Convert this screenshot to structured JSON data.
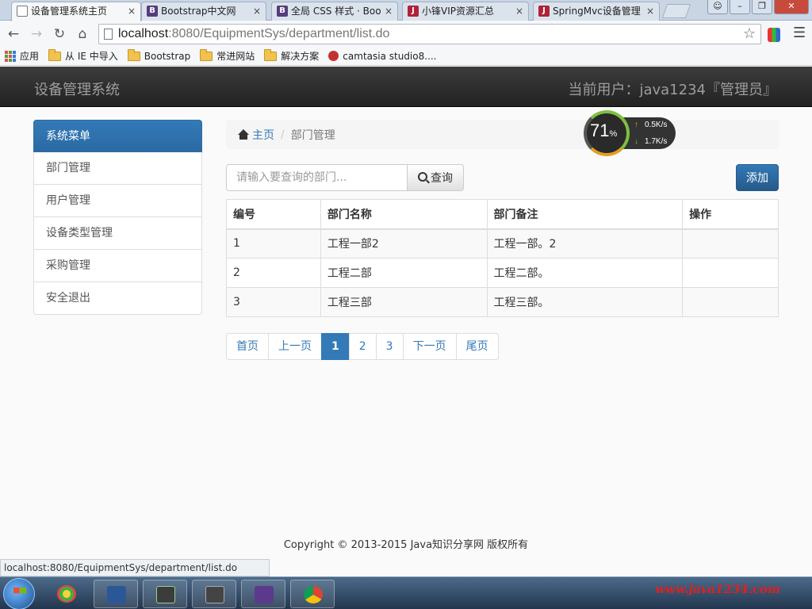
{
  "browser": {
    "tabs": [
      {
        "label": "设备管理系统主页",
        "favicon": "page-icon",
        "active": true
      },
      {
        "label": "Bootstrap中文网",
        "favicon": "B",
        "active": false
      },
      {
        "label": "全局 CSS 样式 · Boo",
        "favicon": "B",
        "active": false
      },
      {
        "label": "小锋VIP资源汇总",
        "favicon": "J",
        "active": false
      },
      {
        "label": "SpringMvc设备管理",
        "favicon": "J",
        "active": false
      }
    ],
    "tab_close": "×",
    "url_host": "localhost",
    "url_rest": ":8080/EquipmentSys/department/list.do",
    "bookmarks": [
      {
        "label": "应用",
        "icon": "apps-icon"
      },
      {
        "label": "从 IE 中导入",
        "icon": "folder-icon"
      },
      {
        "label": "Bootstrap",
        "icon": "folder-icon"
      },
      {
        "label": "常进网站",
        "icon": "folder-icon"
      },
      {
        "label": "解决方案",
        "icon": "folder-icon"
      },
      {
        "label": "camtasia studio8....",
        "icon": "camtasia-icon"
      }
    ],
    "status_url": "localhost:8080/EquipmentSys/department/list.do"
  },
  "navbar": {
    "brand": "设备管理系统",
    "user": "当前用户：java1234『管理员』"
  },
  "sidebar": {
    "items": [
      {
        "label": "系统菜单",
        "active": true
      },
      {
        "label": "部门管理"
      },
      {
        "label": "用户管理"
      },
      {
        "label": "设备类型管理"
      },
      {
        "label": "采购管理"
      },
      {
        "label": "安全退出"
      }
    ]
  },
  "breadcrumb": {
    "home": "主页",
    "current": "部门管理"
  },
  "speed_widget": {
    "percent": "71",
    "percent_unit": "%",
    "upload": "0.5K/s",
    "download": "1.7K/s"
  },
  "search": {
    "placeholder": "请输入要查询的部门...",
    "button": "查询"
  },
  "add_button": "添加",
  "table": {
    "headers": [
      "编号",
      "部门名称",
      "部门备注",
      "操作"
    ],
    "rows": [
      [
        "1",
        "工程一部2",
        "工程一部。2",
        ""
      ],
      [
        "2",
        "工程二部",
        "工程二部。",
        ""
      ],
      [
        "3",
        "工程三部",
        "工程三部。",
        ""
      ]
    ]
  },
  "pagination": {
    "items": [
      "首页",
      "上一页",
      "1",
      "2",
      "3",
      "下一页",
      "尾页"
    ],
    "active": "1"
  },
  "footer": "Copyright © 2013-2015 Java知识分享网 版权所有",
  "taskbar": {
    "watermark": "www.java1234.com"
  },
  "colors": {
    "primary": "#337ab7",
    "navbar": "#222222"
  }
}
